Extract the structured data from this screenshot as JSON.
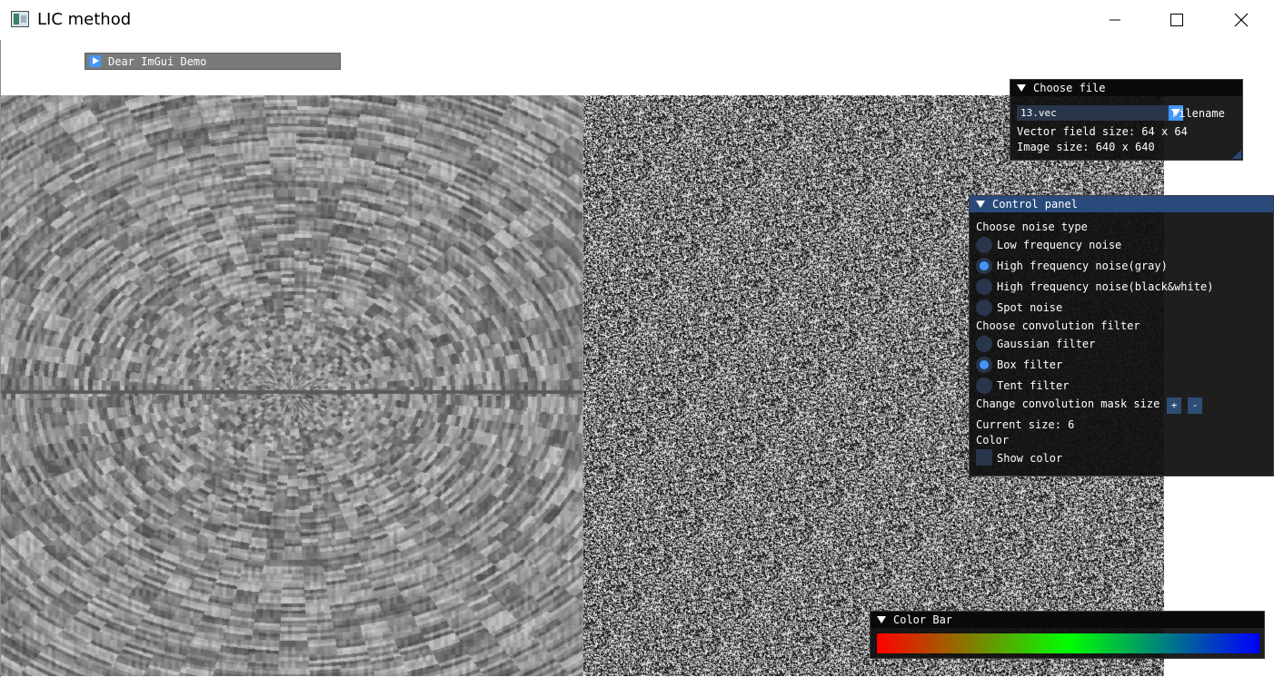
{
  "window": {
    "title": "LIC method",
    "controls": {
      "minimize_icon": "minimize-icon",
      "maximize_icon": "maximize-icon",
      "close_icon": "close-icon"
    }
  },
  "demo_window": {
    "label": "Dear ImGui Demo",
    "collapsed": true
  },
  "file_panel": {
    "title": "Choose file",
    "selected_file": "13.vec",
    "combo_label": "Filename",
    "vector_field_size": "Vector field size: 64 x 64",
    "image_size": "Image size: 640 x 640"
  },
  "control_panel": {
    "title": "Control panel",
    "noise_heading": "Choose noise type",
    "noise_options": [
      {
        "label": "Low frequency noise",
        "selected": false
      },
      {
        "label": "High frequency noise(gray)",
        "selected": true
      },
      {
        "label": "High frequency noise(black&white)",
        "selected": false
      },
      {
        "label": "Spot noise",
        "selected": false
      }
    ],
    "filter_heading": "Choose convolution filter",
    "filter_options": [
      {
        "label": "Gaussian filter",
        "selected": false
      },
      {
        "label": "Box filter",
        "selected": true
      },
      {
        "label": "Tent filter",
        "selected": false
      }
    ],
    "mask_heading": "Change convolution mask size",
    "plus_label": "+",
    "minus_label": "-",
    "current_size": "Current size: 6",
    "color_heading": "Color",
    "show_color_label": "Show color",
    "show_color_checked": false
  },
  "color_bar": {
    "title": "Color Bar",
    "colors": [
      "#ff0000",
      "#808000",
      "#00ff00",
      "#007f80",
      "#0000ff"
    ]
  },
  "colors": {
    "accent": "#4296fa",
    "title_active": "#294a7a",
    "window_bg": "#101010",
    "frame_bg": "#29354a"
  }
}
